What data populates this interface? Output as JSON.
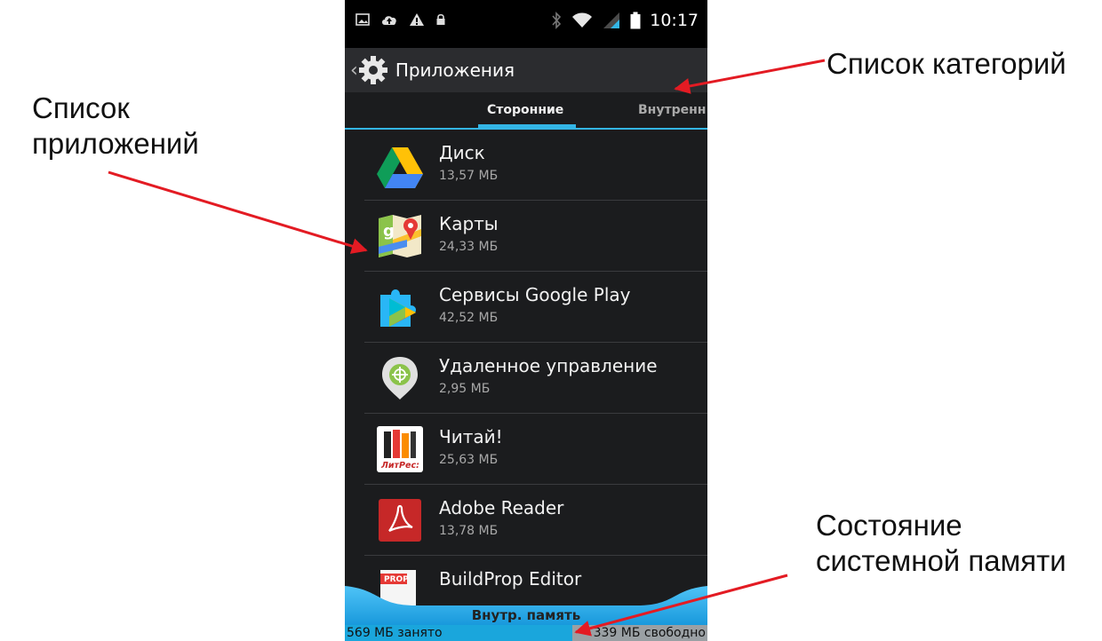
{
  "annotations": {
    "app_list_line1": "Список",
    "app_list_line2": "приложений",
    "category_list": "Список категорий",
    "memory_line1": "Состояние",
    "memory_line2": "системной памяти",
    "arrow_color": "#e31b23"
  },
  "status_bar": {
    "time": "10:17",
    "left_icons": [
      "image-icon",
      "cloud-upload-icon",
      "warning-icon",
      "lock-icon"
    ],
    "right_icons": [
      "bluetooth-icon",
      "wifi-icon",
      "signal-icon",
      "battery-icon"
    ]
  },
  "action_bar": {
    "title": "Приложения",
    "icon": "settings-gear-icon"
  },
  "tabs": [
    {
      "label": "Сторонние",
      "active": true
    },
    {
      "label": "Внутренн",
      "active": false
    }
  ],
  "apps": [
    {
      "name": "Диск",
      "size": "13,57 МБ",
      "icon": "google-drive-icon"
    },
    {
      "name": "Карты",
      "size": "24,33 МБ",
      "icon": "google-maps-icon"
    },
    {
      "name": "Сервисы Google Play",
      "size": "42,52 МБ",
      "icon": "google-play-services-icon"
    },
    {
      "name": "Удаленное управление",
      "size": "2,95 МБ",
      "icon": "device-manager-icon"
    },
    {
      "name": "Читай!",
      "size": "25,63 МБ",
      "icon": "litres-icon",
      "icon_text": "ЛитРес:"
    },
    {
      "name": "Adobe Reader",
      "size": "13,78 МБ",
      "icon": "adobe-reader-icon"
    },
    {
      "name": "BuildProp Editor",
      "size": "",
      "icon": "buildprop-editor-icon",
      "icon_text": "PROP"
    }
  ],
  "storage": {
    "label": "Внутр. память",
    "used": "569 МБ занято",
    "free": "339 МБ свободно",
    "used_fraction": 0.627
  },
  "colors": {
    "accent": "#33b5e5",
    "storage_fill": "#1aa6dc"
  }
}
